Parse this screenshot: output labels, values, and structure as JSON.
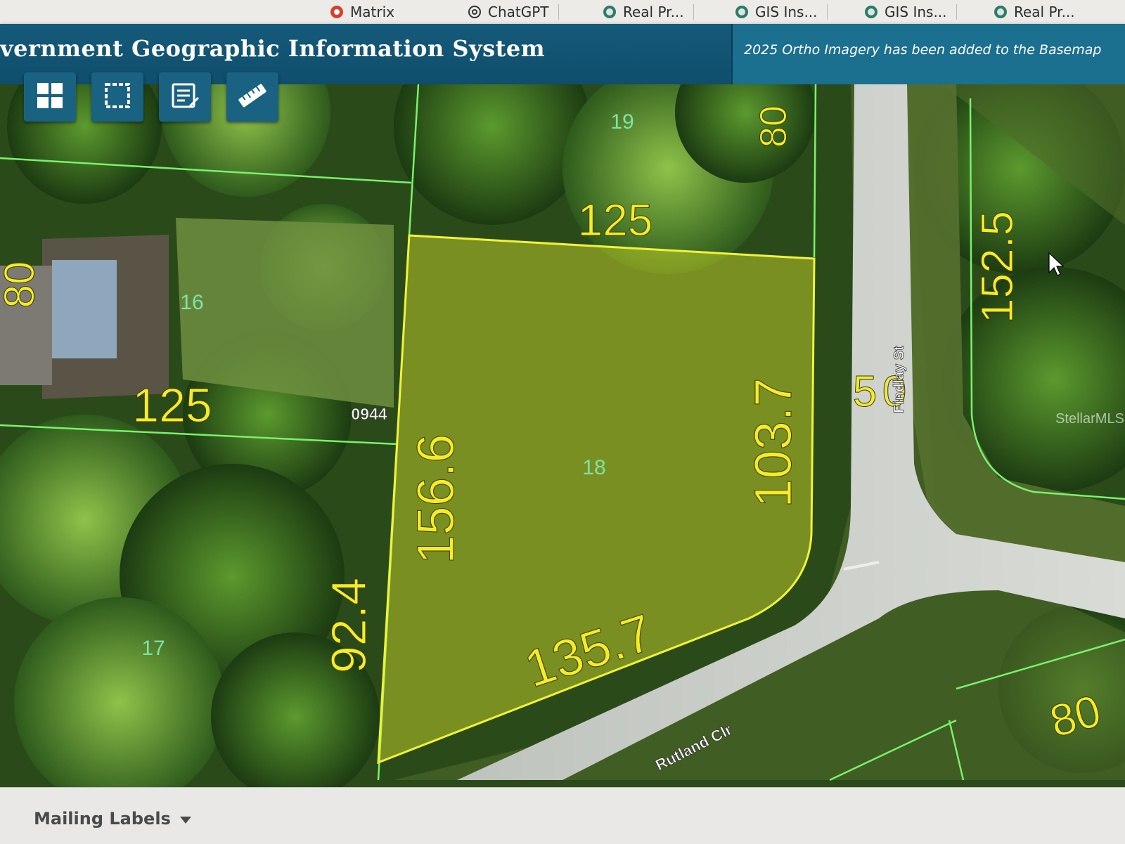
{
  "browser_tabs": [
    {
      "label": "Matrix",
      "icon": "matrix-favicon-icon"
    },
    {
      "label": "ChatGPT",
      "icon": "chatgpt-favicon-icon"
    },
    {
      "label": "Real Pr...",
      "icon": "seal-favicon-icon"
    },
    {
      "label": "GIS Ins...",
      "icon": "seal-favicon-icon"
    },
    {
      "label": "GIS Ins...",
      "icon": "seal-favicon-icon"
    },
    {
      "label": "Real Pr...",
      "icon": "seal-favicon-icon"
    }
  ],
  "header": {
    "title": "vernment Geographic Information System",
    "banner": "2025 Ortho Imagery has been added to the Basemap"
  },
  "toolbar": [
    {
      "name": "basemap-grid-button",
      "icon": "grid-icon"
    },
    {
      "name": "select-box-button",
      "icon": "selection-icon"
    },
    {
      "name": "report-button",
      "icon": "edit-list-icon"
    },
    {
      "name": "measure-button",
      "icon": "ruler-icon"
    }
  ],
  "map": {
    "dimensions": [
      "125",
      "80",
      "152.5",
      "80",
      "125",
      "0944",
      "156.6",
      "103.7",
      "135.7",
      "92.4",
      "80",
      "5",
      "0"
    ],
    "lots": [
      "19",
      "16",
      "18",
      "17"
    ],
    "streets": [
      "Findlay St",
      "Rutland Clr"
    ],
    "watermark": "StellarMLS",
    "colors": {
      "selection": "#e8ee2a",
      "parcel_line": "#79f26a",
      "dimension_text": "#f4ec27"
    }
  },
  "bottom": {
    "mailing_labels": "Mailing Labels"
  }
}
